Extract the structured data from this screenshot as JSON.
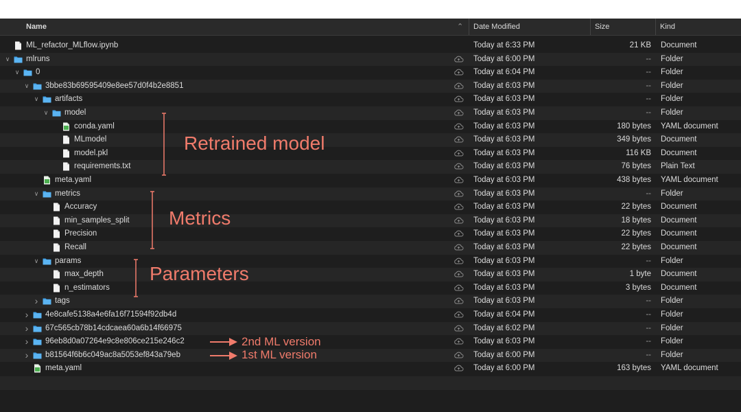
{
  "columns": {
    "name": "Name",
    "date": "Date Modified",
    "size": "Size",
    "kind": "Kind",
    "sort_indicator": "^"
  },
  "icons": {
    "folder": "folder-icon",
    "document": "document-icon",
    "yaml": "yaml-document-icon",
    "cloud": "cloud-icon",
    "chevron_down": "chevron-down-icon",
    "chevron_right": "chevron-right-icon"
  },
  "rows": [
    {
      "name": "ML_refactor_MLflow.ipynb",
      "date": "Today at 6:33 PM",
      "size": "21 KB",
      "kind": "Document"
    },
    {
      "name": "mlruns",
      "date": "Today at 6:00 PM",
      "size": "--",
      "kind": "Folder"
    },
    {
      "name": "0",
      "date": "Today at 6:04 PM",
      "size": "--",
      "kind": "Folder"
    },
    {
      "name": "3bbe83b69595409e8ee57d0f4b2e8851",
      "date": "Today at 6:03 PM",
      "size": "--",
      "kind": "Folder"
    },
    {
      "name": "artifacts",
      "date": "Today at 6:03 PM",
      "size": "--",
      "kind": "Folder"
    },
    {
      "name": "model",
      "date": "Today at 6:03 PM",
      "size": "--",
      "kind": "Folder"
    },
    {
      "name": "conda.yaml",
      "date": "Today at 6:03 PM",
      "size": "180 bytes",
      "kind": "YAML document"
    },
    {
      "name": "MLmodel",
      "date": "Today at 6:03 PM",
      "size": "349 bytes",
      "kind": "Document"
    },
    {
      "name": "model.pkl",
      "date": "Today at 6:03 PM",
      "size": "116 KB",
      "kind": "Document"
    },
    {
      "name": "requirements.txt",
      "date": "Today at 6:03 PM",
      "size": "76 bytes",
      "kind": "Plain Text"
    },
    {
      "name": "meta.yaml",
      "date": "Today at 6:03 PM",
      "size": "438 bytes",
      "kind": "YAML document"
    },
    {
      "name": "metrics",
      "date": "Today at 6:03 PM",
      "size": "--",
      "kind": "Folder"
    },
    {
      "name": "Accuracy",
      "date": "Today at 6:03 PM",
      "size": "22 bytes",
      "kind": "Document"
    },
    {
      "name": "min_samples_split",
      "date": "Today at 6:03 PM",
      "size": "18 bytes",
      "kind": "Document"
    },
    {
      "name": "Precision",
      "date": "Today at 6:03 PM",
      "size": "22 bytes",
      "kind": "Document"
    },
    {
      "name": "Recall",
      "date": "Today at 6:03 PM",
      "size": "22 bytes",
      "kind": "Document"
    },
    {
      "name": "params",
      "date": "Today at 6:03 PM",
      "size": "--",
      "kind": "Folder"
    },
    {
      "name": "max_depth",
      "date": "Today at 6:03 PM",
      "size": "1 byte",
      "kind": "Document"
    },
    {
      "name": "n_estimators",
      "date": "Today at 6:03 PM",
      "size": "3 bytes",
      "kind": "Document"
    },
    {
      "name": "tags",
      "date": "Today at 6:03 PM",
      "size": "--",
      "kind": "Folder"
    },
    {
      "name": "4e8cafe5138a4e6fa16f71594f92db4d",
      "date": "Today at 6:04 PM",
      "size": "--",
      "kind": "Folder"
    },
    {
      "name": "67c565cb78b14cdcaea60a6b14f66975",
      "date": "Today at 6:02 PM",
      "size": "--",
      "kind": "Folder"
    },
    {
      "name": "96eb8d0a07264e9c8e806ce215e246c2",
      "date": "Today at 6:03 PM",
      "size": "--",
      "kind": "Folder"
    },
    {
      "name": "b81564f6b6c049ac8a5053ef843a79eb",
      "date": "Today at 6:00 PM",
      "size": "--",
      "kind": "Folder"
    },
    {
      "name": "meta.yaml",
      "date": "Today at 6:00 PM",
      "size": "163 bytes",
      "kind": "YAML document"
    }
  ],
  "annotations": {
    "retrained": "Retrained model",
    "metrics": "Metrics",
    "parameters": "Parameters",
    "v2": "2nd ML version",
    "v1": "1st ML version",
    "accent_color": "#f07b6b"
  },
  "colors": {
    "folder_blue": "#3fa0e8",
    "background": "#1e1e1e"
  }
}
